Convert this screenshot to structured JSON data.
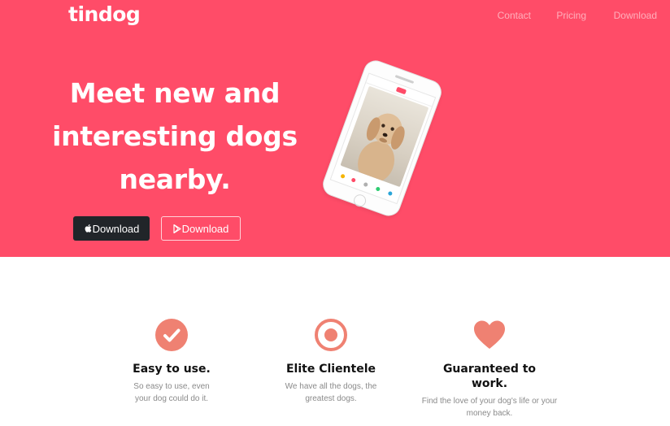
{
  "brand": "tindog",
  "nav": {
    "contact": "Contact",
    "pricing": "Pricing",
    "download": "Download"
  },
  "hero": {
    "headline": "Meet new and interesting dogs nearby.",
    "buttons": {
      "apple": "Download",
      "play": "Download"
    }
  },
  "features": [
    {
      "icon": "check-circle-icon",
      "title": "Easy to use.",
      "text": "So easy to use, even your dog could do it."
    },
    {
      "icon": "bullseye-icon",
      "title": "Elite Clientele",
      "text": "We have all the dogs, the greatest dogs."
    },
    {
      "icon": "heart-icon",
      "title": "Guaranteed to work.",
      "text": "Find the love of your dog's life or your money back."
    }
  ],
  "colors": {
    "brand": "#ff4c68",
    "dark_button": "#212529",
    "feature_icon": "#ef8172"
  }
}
